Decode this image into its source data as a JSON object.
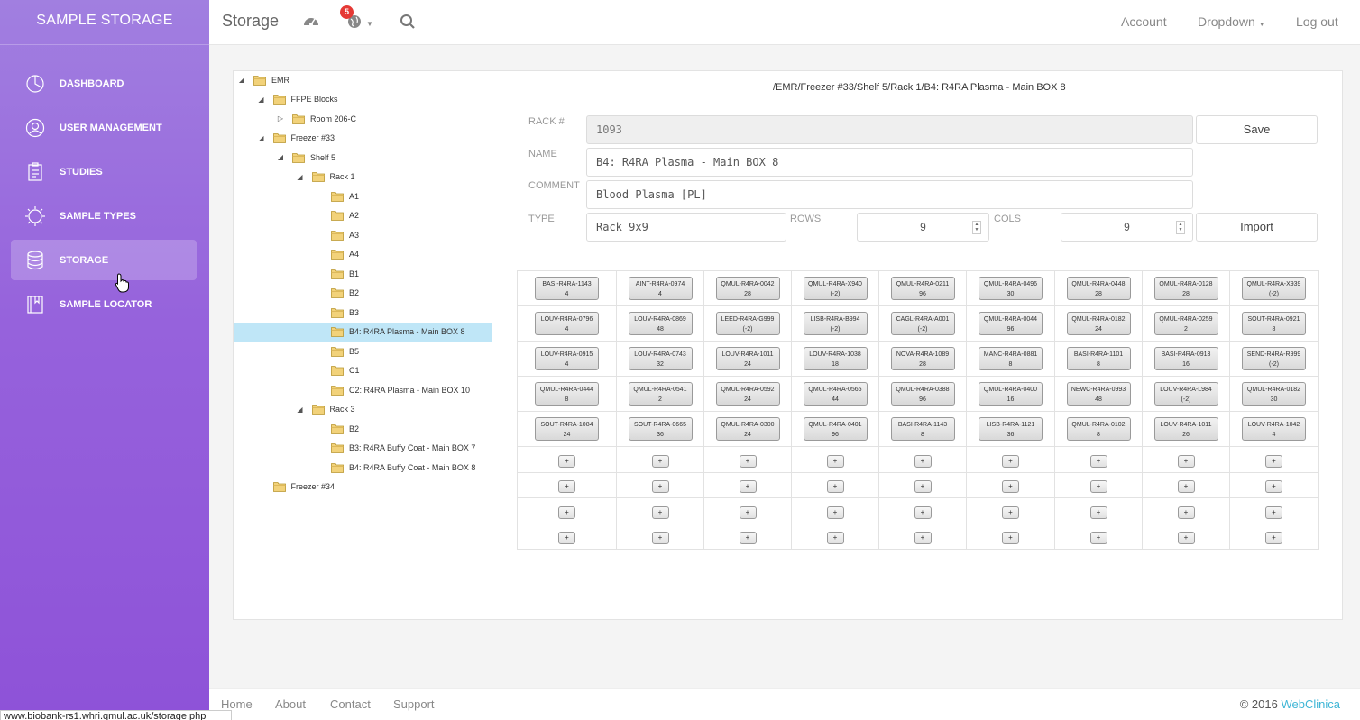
{
  "app": {
    "brand": "SAMPLE STORAGE"
  },
  "sidebar": {
    "items": [
      {
        "label": "DASHBOARD",
        "icon": "pie-chart-icon",
        "active": false
      },
      {
        "label": "USER MANAGEMENT",
        "icon": "user-icon",
        "active": false
      },
      {
        "label": "STUDIES",
        "icon": "clipboard-icon",
        "active": false
      },
      {
        "label": "SAMPLE TYPES",
        "icon": "sun-icon",
        "active": true
      },
      {
        "label": "STORAGE",
        "icon": "database-icon",
        "active": true
      },
      {
        "label": "SAMPLE LOCATOR",
        "icon": "book-icon",
        "active": false
      }
    ]
  },
  "header": {
    "title": "Storage",
    "notifications": "5",
    "account": "Account",
    "dropdown": "Dropdown",
    "logout": "Log out"
  },
  "tree": [
    {
      "label": "EMR",
      "depth": 0,
      "expander": "open"
    },
    {
      "label": "FFPE Blocks",
      "depth": 1,
      "expander": "open"
    },
    {
      "label": "Room 206-C",
      "depth": 2,
      "expander": "closed"
    },
    {
      "label": "Freezer #33",
      "depth": 1,
      "expander": "open"
    },
    {
      "label": "Shelf 5",
      "depth": 2,
      "expander": "open"
    },
    {
      "label": "Rack 1",
      "depth": 3,
      "expander": "open"
    },
    {
      "label": "A1",
      "depth": 4,
      "expander": "none"
    },
    {
      "label": "A2",
      "depth": 4,
      "expander": "none"
    },
    {
      "label": "A3",
      "depth": 4,
      "expander": "none"
    },
    {
      "label": "A4",
      "depth": 4,
      "expander": "none"
    },
    {
      "label": "B1",
      "depth": 4,
      "expander": "none"
    },
    {
      "label": "B2",
      "depth": 4,
      "expander": "none"
    },
    {
      "label": "B3",
      "depth": 4,
      "expander": "none"
    },
    {
      "label": "B4: R4RA Plasma - Main BOX 8",
      "depth": 4,
      "expander": "none",
      "selected": true
    },
    {
      "label": "B5",
      "depth": 4,
      "expander": "none"
    },
    {
      "label": "C1",
      "depth": 4,
      "expander": "none"
    },
    {
      "label": "C2: R4RA Plasma - Main BOX 10",
      "depth": 4,
      "expander": "none"
    },
    {
      "label": "Rack 3",
      "depth": 3,
      "expander": "open"
    },
    {
      "label": "B2",
      "depth": 4,
      "expander": "none"
    },
    {
      "label": "B3: R4RA Buffy Coat - Main BOX 7",
      "depth": 4,
      "expander": "none"
    },
    {
      "label": "B4: R4RA Buffy Coat - Main BOX 8",
      "depth": 4,
      "expander": "none"
    },
    {
      "label": "Freezer #34",
      "depth": 1,
      "expander": "none"
    }
  ],
  "form": {
    "path": "/EMR/Freezer #33/Shelf 5/Rack 1/B4: R4RA Plasma - Main BOX 8",
    "rack_label": "RACK #",
    "rack_value": "1093",
    "name_label": "NAME",
    "name_value": "B4: R4RA Plasma - Main BOX 8",
    "comment_label": "COMMENT",
    "comment_value": "Blood Plasma [PL]",
    "type_label": "TYPE",
    "type_value": "Rack 9x9",
    "rows_label": "ROWS",
    "rows_value": "9",
    "cols_label": "COLS",
    "cols_value": "9",
    "save_label": "Save",
    "import_label": "Import"
  },
  "grid": {
    "filled_rows": [
      [
        [
          "BASI-R4RA-1143",
          "4"
        ],
        [
          "AINT-R4RA-0974",
          "4"
        ],
        [
          "QMUL-R4RA-0042",
          "28"
        ],
        [
          "QMUL-R4RA-X940",
          "(-2)"
        ],
        [
          "QMUL-R4RA-0211",
          "96"
        ],
        [
          "QMUL-R4RA-0496",
          "30"
        ],
        [
          "QMUL-R4RA-0448",
          "28"
        ],
        [
          "QMUL-R4RA-0128",
          "28"
        ],
        [
          "QMUL-R4RA-X939",
          "(-2)"
        ]
      ],
      [
        [
          "LOUV-R4RA-0796",
          "4"
        ],
        [
          "LOUV-R4RA-0869",
          "48"
        ],
        [
          "LEED-R4RA-G999",
          "(-2)"
        ],
        [
          "LISB-R4RA-B994",
          "(-2)"
        ],
        [
          "CAGL-R4RA-A001",
          "(-2)"
        ],
        [
          "QMUL-R4RA-0044",
          "96"
        ],
        [
          "QMUL-R4RA-0182",
          "24"
        ],
        [
          "QMUL-R4RA-0259",
          "2"
        ],
        [
          "SOUT-R4RA-0921",
          "8"
        ]
      ],
      [
        [
          "LOUV-R4RA-0915",
          "4"
        ],
        [
          "LOUV-R4RA-0743",
          "32"
        ],
        [
          "LOUV-R4RA-1011",
          "24"
        ],
        [
          "LOUV-R4RA-1038",
          "18"
        ],
        [
          "NOVA-R4RA-1089",
          "28"
        ],
        [
          "MANC-R4RA-0881",
          "8"
        ],
        [
          "BASI-R4RA-1101",
          "8"
        ],
        [
          "BASI-R4RA-0913",
          "16"
        ],
        [
          "SEND-R4RA-R999",
          "(-2)"
        ]
      ],
      [
        [
          "QMUL-R4RA-0444",
          "8"
        ],
        [
          "QMUL-R4RA-0541",
          "2"
        ],
        [
          "QMUL-R4RA-0592",
          "24"
        ],
        [
          "QMUL-R4RA-0565",
          "44"
        ],
        [
          "QMUL-R4RA-0388",
          "96"
        ],
        [
          "QMUL-R4RA-0400",
          "16"
        ],
        [
          "NEWC-R4RA-0993",
          "48"
        ],
        [
          "LOUV-R4RA-L984",
          "(-2)"
        ],
        [
          "QMUL-R4RA-0182",
          "30"
        ]
      ],
      [
        [
          "SOUT-R4RA-1084",
          "24"
        ],
        [
          "SOUT-R4RA-0665",
          "36"
        ],
        [
          "QMUL-R4RA-0300",
          "24"
        ],
        [
          "QMUL-R4RA-0401",
          "96"
        ],
        [
          "BASI-R4RA-1143",
          "8"
        ],
        [
          "LISB-R4RA-1121",
          "36"
        ],
        [
          "QMUL-R4RA-0102",
          "8"
        ],
        [
          "LOUV-R4RA-1011",
          "26"
        ],
        [
          "LOUV-R4RA-1042",
          "4"
        ]
      ]
    ],
    "empty_rows": 4,
    "add_label": "+"
  },
  "footer": {
    "links": [
      "Home",
      "About",
      "Contact",
      "Support"
    ],
    "copyright": "© 2016",
    "brand": "WebClinica",
    "brand_color": "#3fb6d6"
  },
  "statusbar": {
    "url": "www.biobank-rs1.whri.qmul.ac.uk/storage.php"
  }
}
